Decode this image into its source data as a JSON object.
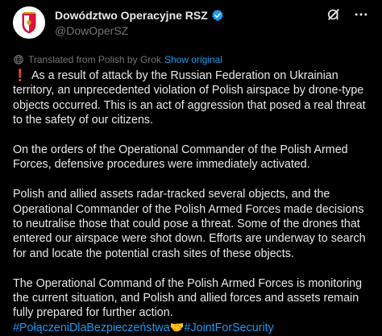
{
  "author": {
    "display_name": "Dowództwo Operacyjne RSZ",
    "handle": "@DowOperSZ",
    "verified_color": "#1d9bf0"
  },
  "icons": {
    "avatar": "polish-military-emblem-icon",
    "grok": "grok-icon",
    "more": "more-options-icon",
    "translate": "globe-icon"
  },
  "translation": {
    "note": "Translated from Polish by Grok",
    "show_original": "Show original"
  },
  "post": {
    "p1_mark": "❗",
    "p1": " As a result of attack by the Russian Federation on Ukrainian territory, an unprecedented violation of Polish airspace by drone-type objects occurred. This is an act of aggression that posed a real threat to the safety of our citizens.",
    "p2": "On the orders of the Operational Commander of the Polish Armed Forces, defensive procedures were immediately activated.",
    "p3": "Polish and allied assets radar-tracked several objects, and the Operational Commander of the Polish Armed Forces made decisions to neutralise those that could pose a threat. Some of the drones that entered our airspace were shot down. Efforts are underway to search for and locate the potential crash sites of these objects.",
    "p4": "The Operational Command of the Polish Armed Forces is monitoring the current situation, and Polish and allied forces and assets remain fully prepared for further action.",
    "hashtag1": "#PołączeniDlaBezpieczeństwa",
    "emoji": "🤝",
    "hashtag2": "#JointForSecurity"
  },
  "colors": {
    "background": "#000000",
    "text": "#e7e9ea",
    "muted": "#71767b",
    "accent": "#1d9bf0",
    "alert": "#f4212e"
  }
}
